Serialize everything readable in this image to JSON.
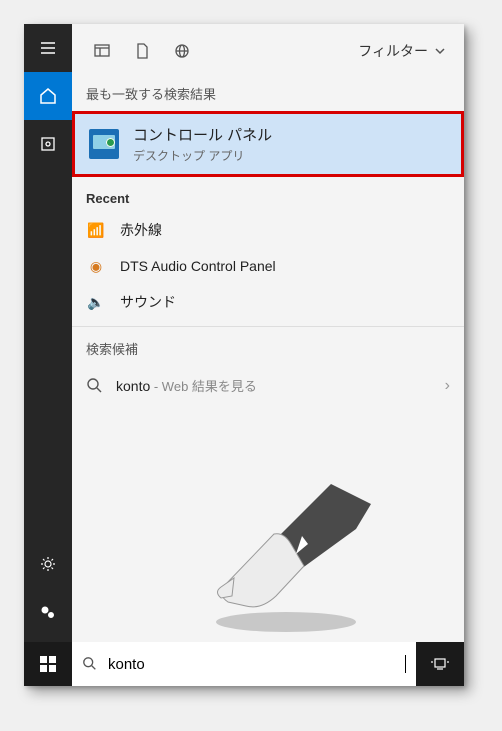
{
  "header": {
    "filter_label": "フィルター"
  },
  "sections": {
    "best_match": "最も一致する検索結果",
    "recent": "Recent",
    "suggestions": "検索候補"
  },
  "best_result": {
    "title": "コントロール パネル",
    "subtitle": "デスクトップ アプリ"
  },
  "recent_items": [
    {
      "icon": "📡",
      "label": "赤外線"
    },
    {
      "icon": "🔊",
      "label": "DTS Audio Control Panel"
    },
    {
      "icon": "🔈",
      "label": "サウンド"
    }
  ],
  "suggestion": {
    "query": "konto",
    "hint": " - Web 結果を見る"
  },
  "search": {
    "value": "konto"
  }
}
